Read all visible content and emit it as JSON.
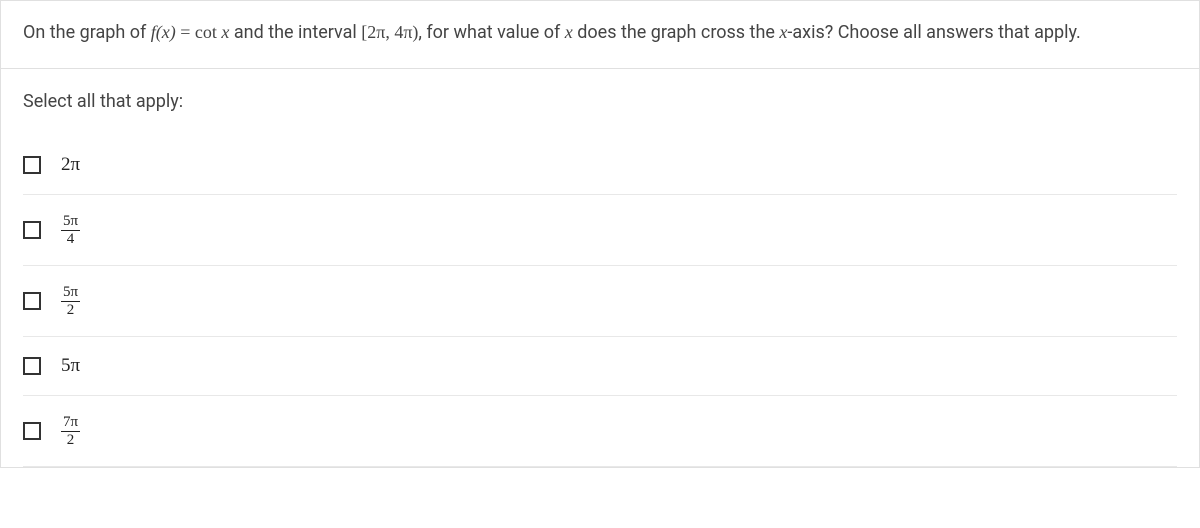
{
  "question": {
    "prefix": "On the graph of ",
    "func_lhs": "f(x)",
    "equals": " = ",
    "func_rhs_op": "cot ",
    "func_rhs_var": "x",
    "mid1": " and the interval ",
    "interval": "[2π, 4π)",
    "mid2": ", for what value of ",
    "var_x": "x",
    "mid3": " does the graph cross the ",
    "axis_var": "x",
    "suffix": "-axis? Choose all answers that apply."
  },
  "prompt": "Select all that apply:",
  "options": [
    {
      "type": "plain",
      "text": "2π"
    },
    {
      "type": "fraction",
      "num": "5π",
      "den": "4"
    },
    {
      "type": "fraction",
      "num": "5π",
      "den": "2"
    },
    {
      "type": "plain",
      "text": "5π"
    },
    {
      "type": "fraction",
      "num": "7π",
      "den": "2"
    }
  ]
}
